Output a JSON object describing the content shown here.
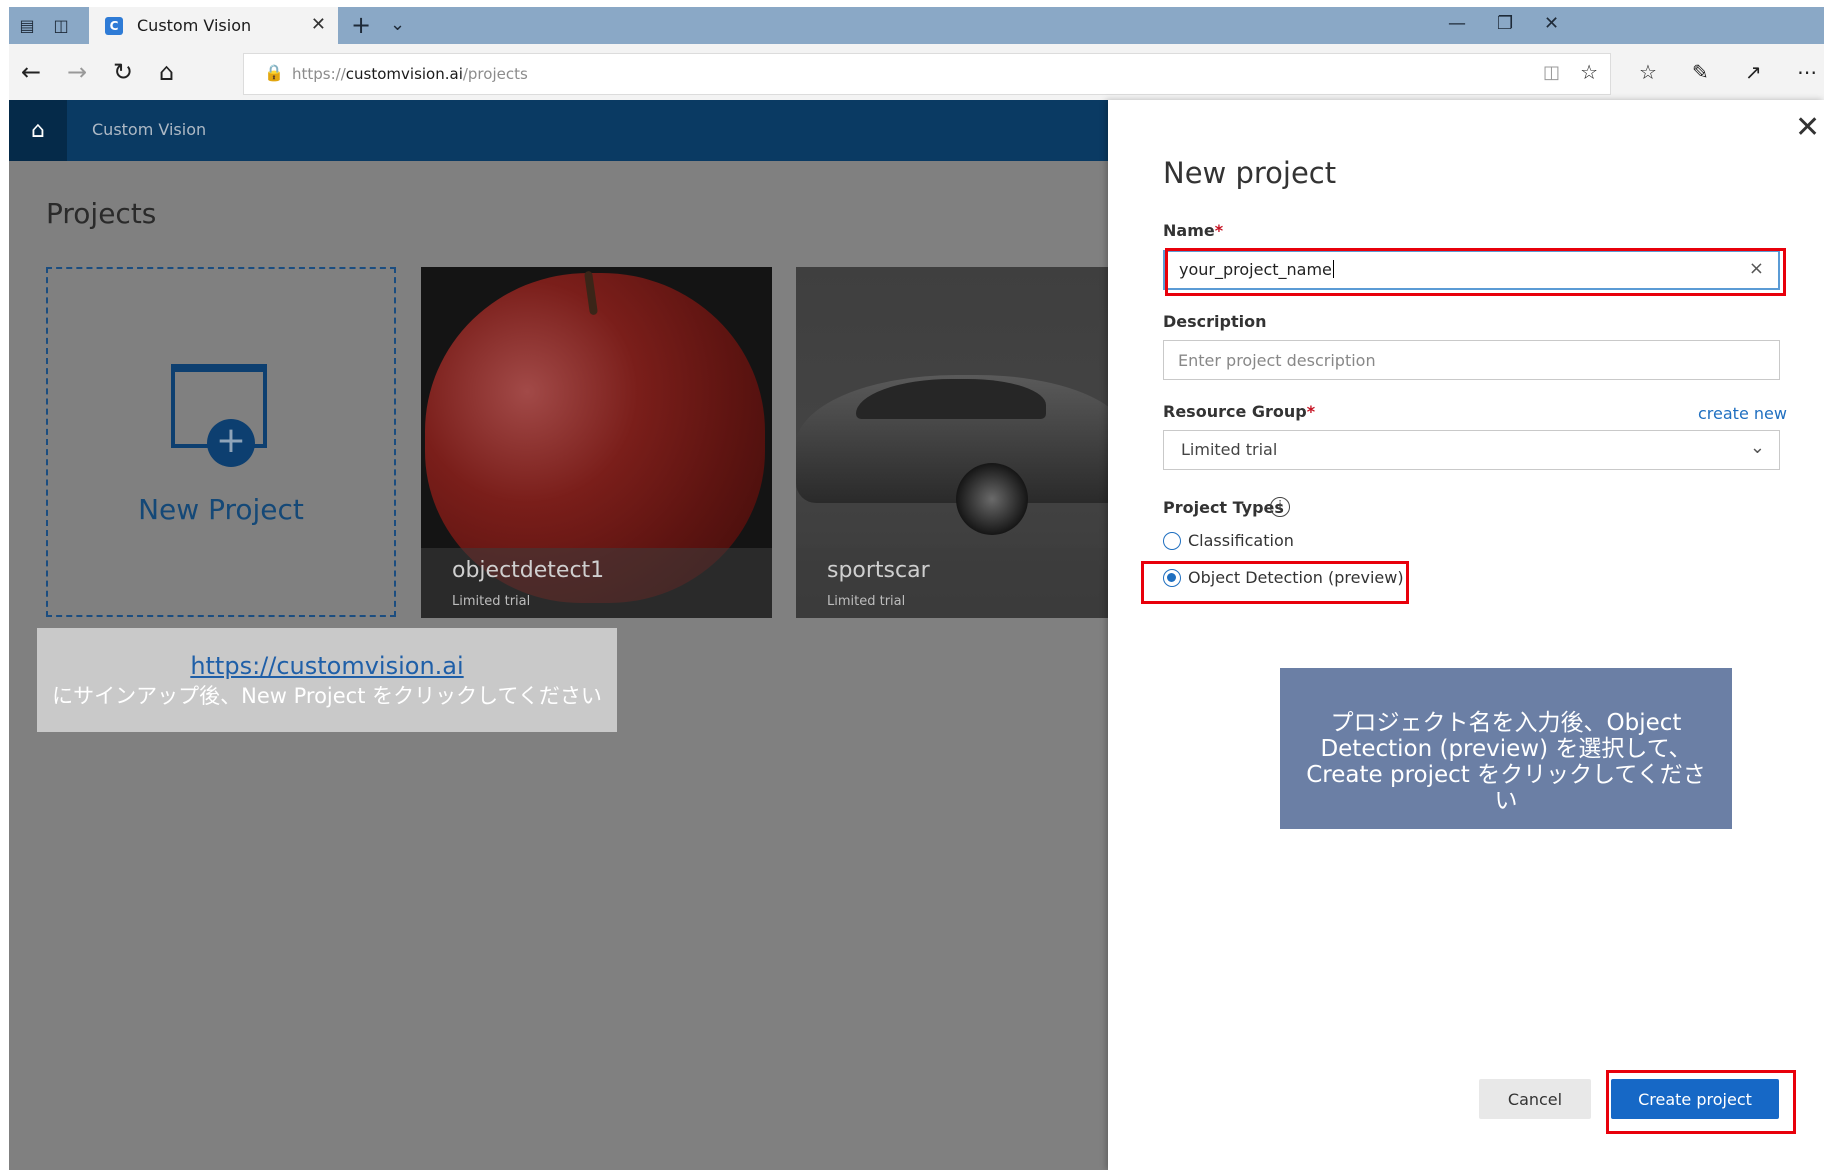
{
  "browser": {
    "tab_title": "Custom Vision",
    "url_prefix": "https://",
    "url_domain": "customvision.ai",
    "url_path": "/projects"
  },
  "app": {
    "brand": "Custom Vision",
    "projects_title": "Projects",
    "new_project_label": "New Project",
    "cards": [
      {
        "title": "objectdetect1",
        "subtitle": "Limited trial"
      },
      {
        "title": "sportscar",
        "subtitle": "Limited trial"
      }
    ]
  },
  "note_left": {
    "link": "https://customvision.ai",
    "text": "にサインアップ後、New Project をクリックしてください"
  },
  "panel": {
    "title": "New project",
    "name_label": "Name",
    "name_value": "your_project_name",
    "description_label": "Description",
    "description_placeholder": "Enter project description",
    "resource_group_label": "Resource Group",
    "create_new": "create new",
    "resource_group_value": "Limited trial",
    "project_types_label": "Project Types",
    "option_classification": "Classification",
    "option_object_detection": "Object Detection (preview)",
    "selected_option": "Object Detection (preview)",
    "cancel": "Cancel",
    "create": "Create project"
  },
  "note_right": {
    "line1": "プロジェクト名を入力後、Object",
    "line2": "Detection (preview) を選択して、",
    "line3": "Create project をクリックしてください"
  },
  "colors": {
    "title_bar": "#8aa8c6",
    "app_header": "#0a3a63",
    "primary_button": "#1668c6",
    "highlight": "#e8000b",
    "note_right_bg": "#6b7fa5"
  }
}
